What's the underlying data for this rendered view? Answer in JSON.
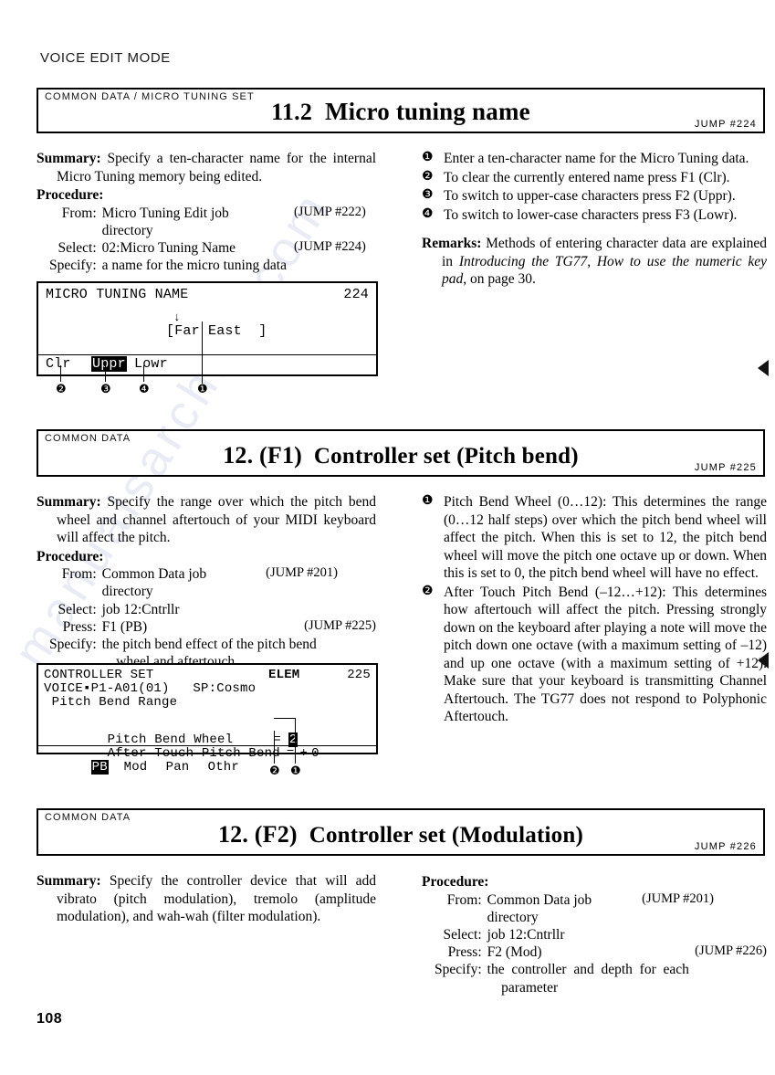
{
  "page": {
    "running_head": "VOICE EDIT MODE",
    "folio": "108",
    "watermark": "manualsarchive.com"
  },
  "sections": [
    {
      "id": "11.2",
      "kicker": "COMMON DATA / MICRO TUNING SET",
      "number": "11.2",
      "title": "Micro tuning name",
      "jump": "JUMP  #224",
      "summary_label": "Summary:",
      "summary_text": "Specify a ten-character name for the internal Micro Tuning memory being edited.",
      "procedure_label": "Procedure:",
      "procedure": [
        {
          "key": "From:",
          "value": "Micro Tuning Edit job directory",
          "jump": "(JUMP #222)"
        },
        {
          "key": "Select:",
          "value": "02:Micro Tuning Name",
          "jump": "(JUMP #224)"
        },
        {
          "key": "Specify:",
          "value": "a name for the micro tuning data",
          "jump": ""
        }
      ],
      "steps": [
        {
          "mark": "❶",
          "text": "Enter a ten-character name for the Micro Tuning data."
        },
        {
          "mark": "❷",
          "text": "To clear the currently entered name press F1 (Clr)."
        },
        {
          "mark": "❸",
          "text": "To switch to upper-case characters press F2 (Uppr)."
        },
        {
          "mark": "❹",
          "text": "To switch to lower-case characters press F3 (Lowr)."
        }
      ],
      "remarks_label": "Remarks:",
      "remarks_text_1": "Methods of entering character data are explained in ",
      "remarks_italic_1": "Introducing the TG77, How to use the numeric key pad",
      "remarks_text_2": ", on page 30."
    },
    {
      "id": "12.F1",
      "kicker": "COMMON DATA",
      "number": "12. (F1)",
      "title": "Controller set (Pitch bend)",
      "jump": "JUMP  #225",
      "summary_label": "Summary:",
      "summary_text": "Specify the range over which the pitch bend wheel and channel aftertouch of your MIDI keyboard will affect the pitch.",
      "procedure_label": "Procedure:",
      "procedure": [
        {
          "key": "From:",
          "value": "Common Data job directory",
          "jump": "(JUMP #201)"
        },
        {
          "key": "Select:",
          "value": "job 12:Cntrllr",
          "jump": ""
        },
        {
          "key": "Press:",
          "value": "F1 (PB)",
          "jump": "(JUMP #225)"
        },
        {
          "key": "Specify:",
          "value": "the pitch bend effect of the pitch bend wheel and aftertouch",
          "jump": ""
        }
      ],
      "steps": [
        {
          "mark": "❶",
          "text": "Pitch Bend Wheel (0…12): This determines the range (0…12 half steps) over which the pitch bend wheel will affect the pitch. When this is set to 12, the pitch bend wheel will move the pitch one octave up or down. When this is set to 0, the pitch bend wheel will have no effect."
        },
        {
          "mark": "❷",
          "text": "After Touch Pitch Bend (–12…+12): This determines how aftertouch will affect the pitch. Pressing strongly down on the keyboard after playing a note will move the pitch down one octave (with a maximum setting of –12) and up one octave (with a maximum setting of +12). Make sure that your keyboard is transmitting Channel Aftertouch. The TG77 does not respond to Polyphonic Aftertouch."
        }
      ]
    },
    {
      "id": "12.F2",
      "kicker": "COMMON DATA",
      "number": "12. (F2)",
      "title": "Controller set (Modulation)",
      "jump": "JUMP  #226",
      "summary_label": "Summary:",
      "summary_text": "Specify the controller device that will add vibrato (pitch modulation), tremolo (amplitude modulation), and wah-wah (filter modulation).",
      "procedure_label": "Procedure:",
      "procedure": [
        {
          "key": "From:",
          "value": "Common Data job directory",
          "jump": "(JUMP #201)"
        },
        {
          "key": "Select:",
          "value": "job 12:Cntrllr",
          "jump": ""
        },
        {
          "key": "Press:",
          "value": "F2 (Mod)",
          "jump": "(JUMP #226)"
        },
        {
          "key": "Specify:",
          "value": "the controller and depth for each parameter",
          "jump": ""
        }
      ]
    }
  ],
  "lcd_micro_tuning": {
    "title": "MICRO TUNING NAME",
    "page_number": "224",
    "cursor_arrow": "↓",
    "name_field": "[Far East  ]",
    "soft_keys": [
      {
        "label": "Clr",
        "highlighted": false,
        "callout": "❷"
      },
      {
        "label": "Uppr",
        "highlighted": true,
        "callout": "❸"
      },
      {
        "label": "Lowr",
        "highlighted": false,
        "callout": "❹"
      }
    ],
    "field_callout": "❶"
  },
  "lcd_controller_set": {
    "title": "CONTROLLER SET",
    "voice_line": "VOICE▪P1-A01(01)   SP:Cosmo",
    "edit_indicator": "ELEM",
    "page_number": "225",
    "subtitle": " Pitch Bend Range",
    "params": [
      {
        "label": "Pitch Bend Wheel",
        "eq": "=",
        "sign": "",
        "value": "2",
        "highlighted": true,
        "callout": "❶"
      },
      {
        "label": "After Touch Pitch Bend",
        "eq": "=",
        "sign": "+",
        "value": "0",
        "highlighted": false,
        "callout": "❷"
      }
    ],
    "soft_keys": [
      {
        "label": "PB",
        "highlighted": true
      },
      {
        "label": "Mod",
        "highlighted": false
      },
      {
        "label": "Pan",
        "highlighted": false
      },
      {
        "label": "Othr",
        "highlighted": false
      }
    ]
  }
}
